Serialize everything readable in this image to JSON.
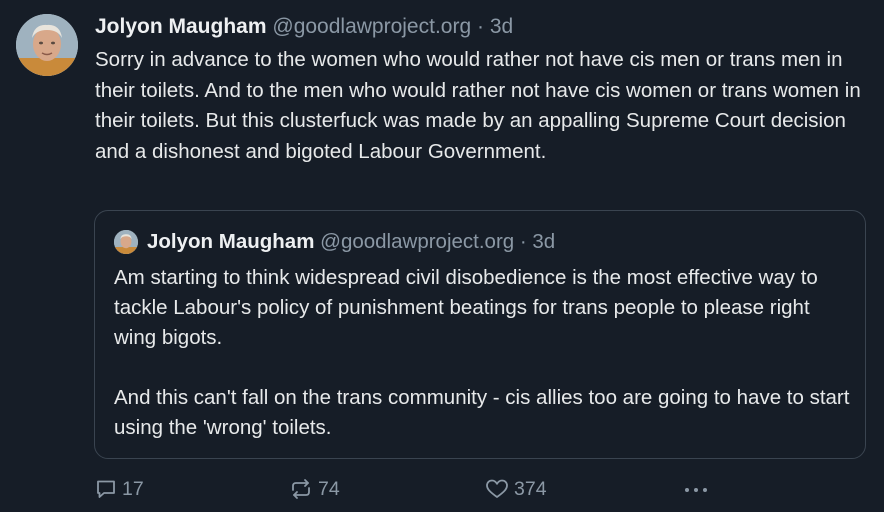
{
  "post": {
    "author_name": "Jolyon Maugham",
    "author_handle": "@goodlawproject.org",
    "separator": "·",
    "time": "3d",
    "text": "Sorry in advance to the women who would rather not have cis men or trans men in their toilets. And to the men who would rather not have cis women or trans women in their toilets. But this clusterfuck was made by an appalling Supreme Court decision and a dishonest and bigoted Labour Government."
  },
  "quoted_post": {
    "author_name": "Jolyon Maugham",
    "author_handle": "@goodlawproject.org",
    "separator": "·",
    "time": "3d",
    "paragraphs": [
      "Am starting to think widespread civil disobedience is the most effective way to tackle Labour's policy of punishment beatings for trans people to please right wing bigots.",
      "And this can't fall on the trans community - cis allies too are going to have to start using the 'wrong' toilets."
    ]
  },
  "actions": {
    "replies": "17",
    "reposts": "74",
    "likes": "374",
    "reply_icon": "reply-icon",
    "repost_icon": "repost-icon",
    "like_icon": "heart-icon",
    "more_icon": "more-icon"
  },
  "colors": {
    "background": "#161d27",
    "text": "#e7e9ea",
    "muted": "#8b98a5",
    "border": "#3a4450"
  }
}
